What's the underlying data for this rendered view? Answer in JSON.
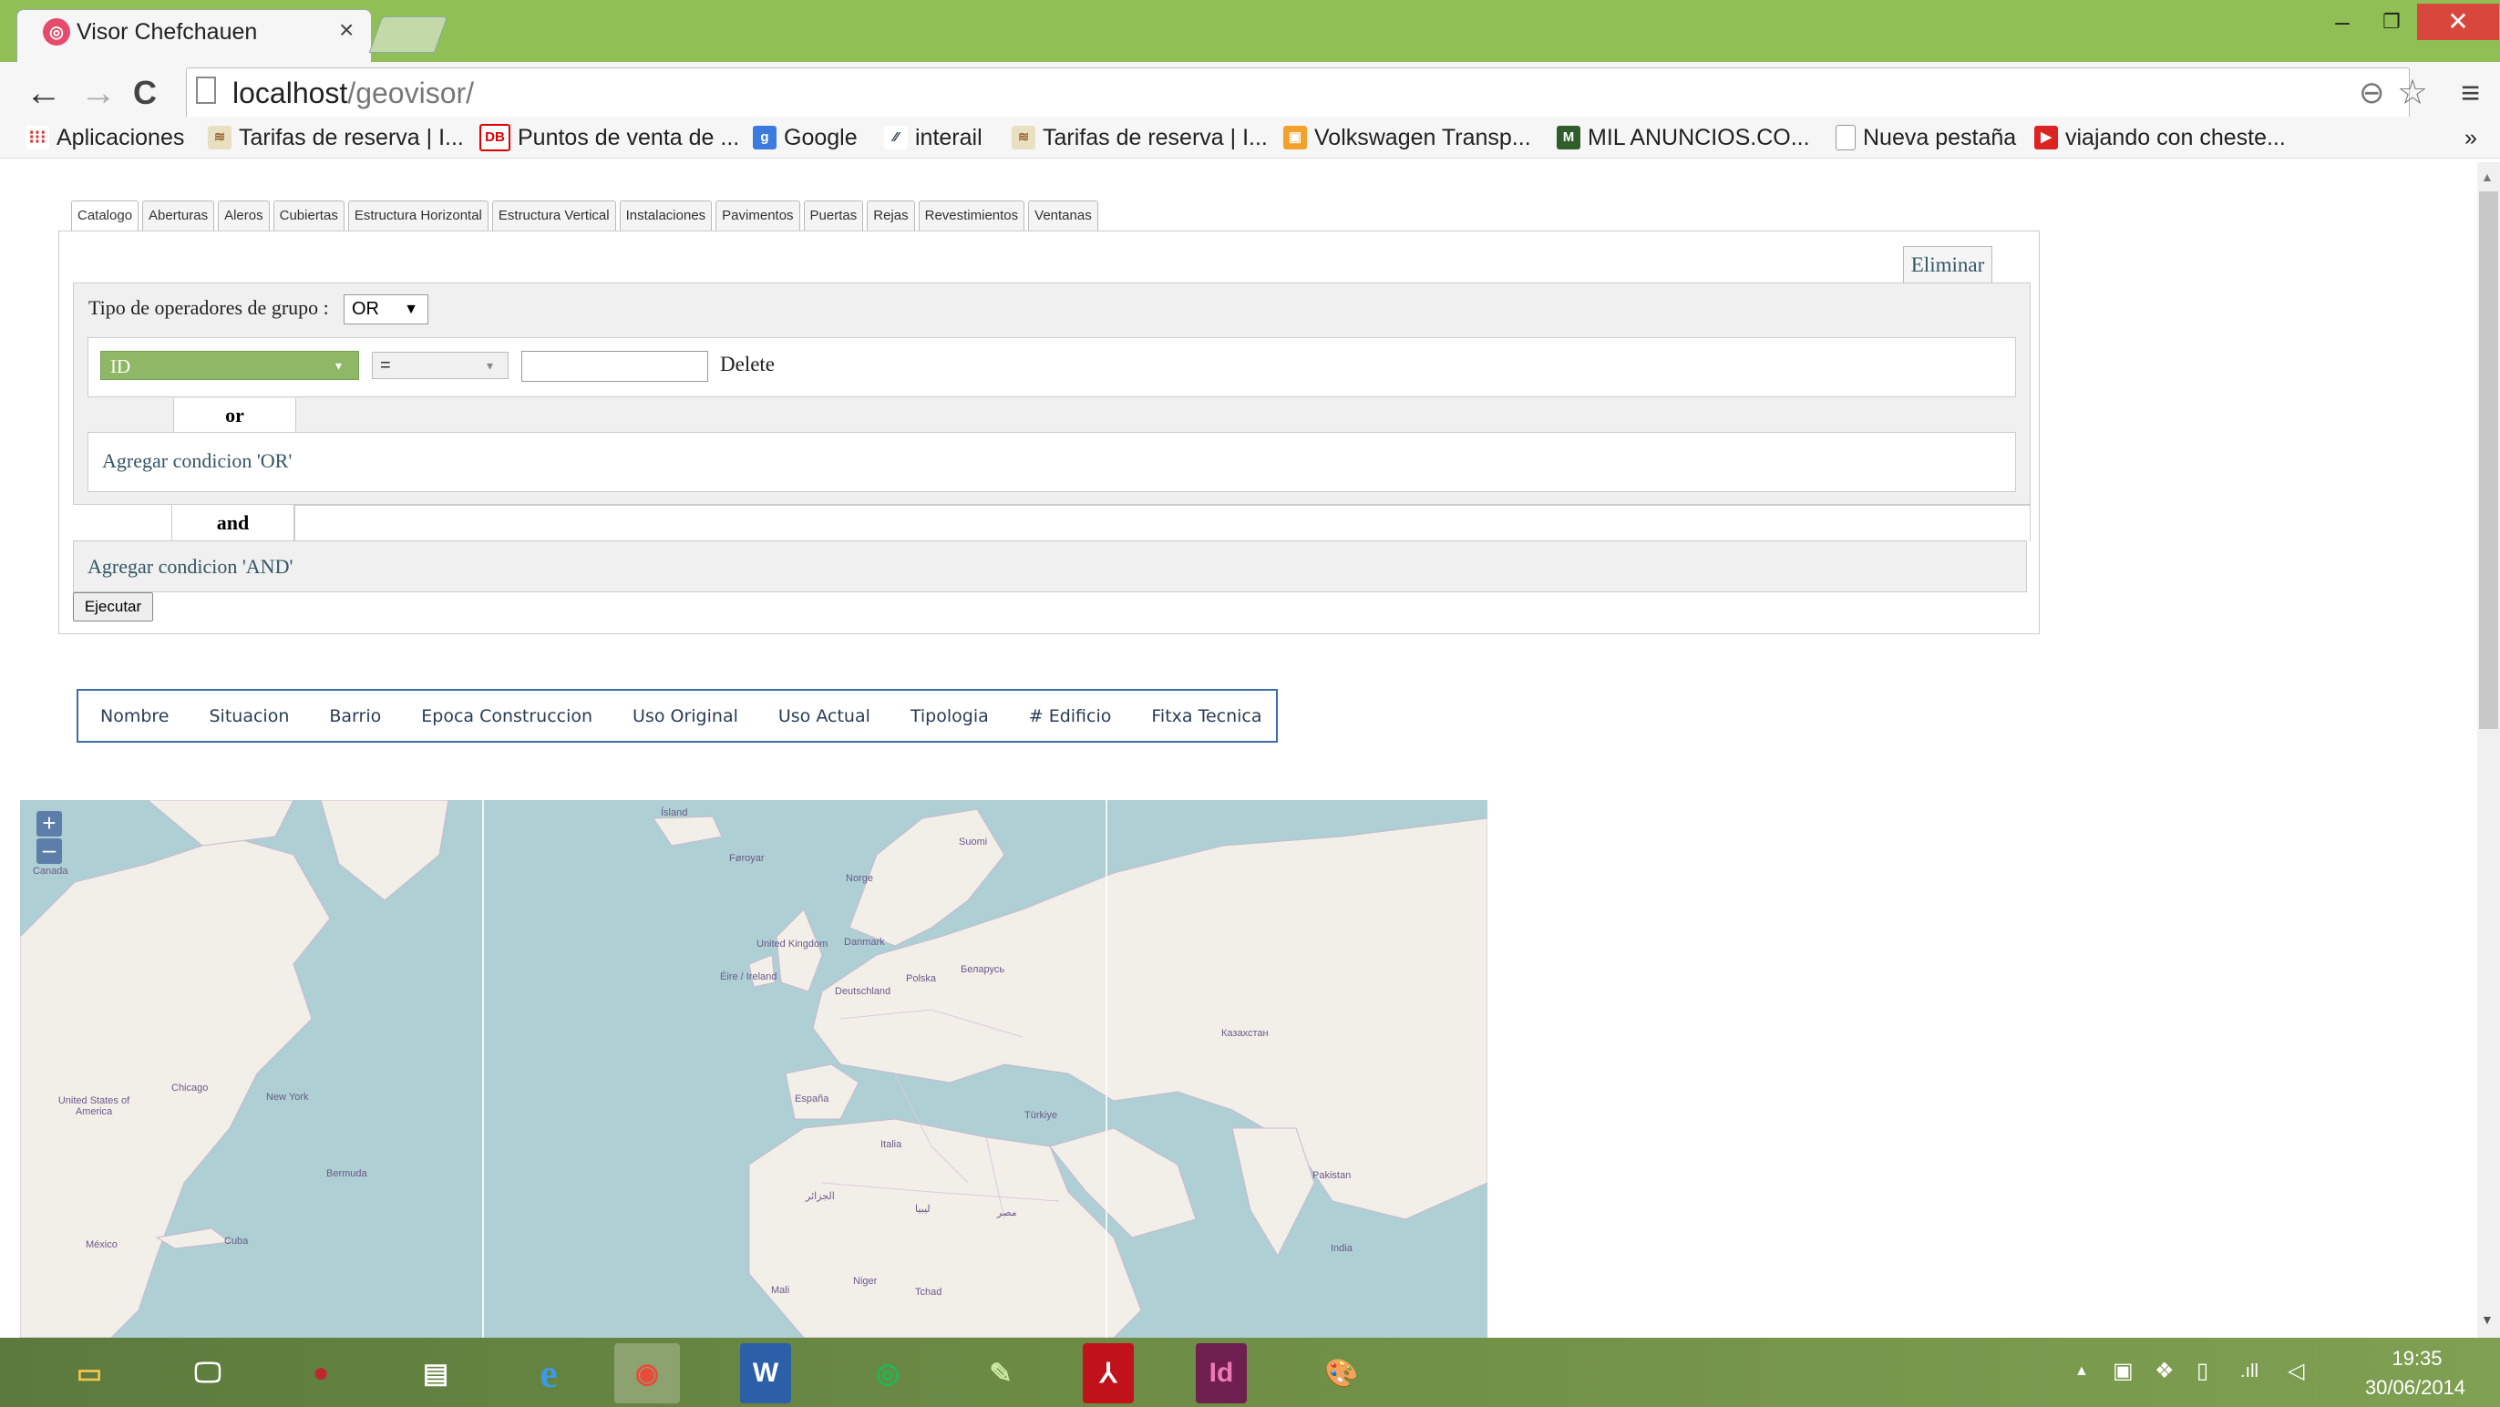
{
  "browser": {
    "tab_title": "Visor Chefchauen",
    "tab_close": "×",
    "url_host": "localhost",
    "url_path": "/geovisor/",
    "window_controls": {
      "minimize": "–",
      "restore": "❐",
      "close": "✕"
    },
    "nav": {
      "back": "←",
      "forward": "→",
      "reload": "C"
    },
    "bookmarks_overflow": "»",
    "bookmarks": [
      {
        "label": "Aplicaciones",
        "icon": "apps-grid-icon"
      },
      {
        "label": "Tarifas de reserva | I...",
        "icon": "renfe-icon"
      },
      {
        "label": "Puntos de venta de ...",
        "icon": "db-icon"
      },
      {
        "label": "Google",
        "icon": "google-icon"
      },
      {
        "label": "interail",
        "icon": "interail-icon"
      },
      {
        "label": "Tarifas de reserva | I...",
        "icon": "renfe-icon"
      },
      {
        "label": "Volkswagen Transp...",
        "icon": "box-icon"
      },
      {
        "label": "MIL ANUNCIOS.CO...",
        "icon": "milanuncios-icon"
      },
      {
        "label": "Nueva pestaña",
        "icon": "page-icon"
      },
      {
        "label": "viajando con cheste...",
        "icon": "youtube-icon"
      }
    ]
  },
  "catalog_tabs": [
    "Catalogo",
    "Aberturas",
    "Aleros",
    "Cubiertas",
    "Estructura Horizontal",
    "Estructura Vertical",
    "Instalaciones",
    "Pavimentos",
    "Puertas",
    "Rejas",
    "Revestimientos",
    "Ventanas"
  ],
  "query_builder": {
    "eliminar": "Eliminar",
    "group_operator_label": "Tipo de operadores de grupo :",
    "group_operator_value": "OR",
    "field_value": "ID",
    "comparator_value": "=",
    "value_input": "",
    "delete_label": "Delete",
    "or_label": "or",
    "add_or_label": "Agregar condicion 'OR'",
    "and_label": "and",
    "add_and_label": "Agregar condicion 'AND'",
    "execute_label": "Ejecutar"
  },
  "results_columns": [
    "Nombre",
    "Situacion",
    "Barrio",
    "Epoca Construccion",
    "Uso Original",
    "Uso Actual",
    "Tipologia",
    "# Edificio",
    "Fitxa Tecnica"
  ],
  "map": {
    "zoom_in": "+",
    "zoom_out": "–",
    "labels": [
      "Ísland",
      "Føroyar",
      "Suomi",
      "Norge",
      "United Kingdom",
      "Danmark",
      "Éire / Ireland",
      "Deutschland",
      "Polska",
      "Беларусь",
      "España",
      "Italia",
      "Türkiye",
      "الجزائر",
      "ليبيا",
      "مصر",
      "Niger",
      "Mali",
      "Tchad",
      "Canada",
      "United States of America",
      "México",
      "Cuba",
      "Казахстан",
      "India",
      "Pakistan",
      "Chicago",
      "New York",
      "Bermuda"
    ]
  },
  "taskbar": {
    "apps": [
      "file-explorer-icon",
      "remote-desktop-icon",
      "media-player-icon",
      "messaging-icon",
      "internet-explorer-icon",
      "chrome-icon",
      "word-icon",
      "spotify-icon",
      "notepadpp-icon",
      "acrobat-icon",
      "indesign-icon",
      "paint-icon"
    ],
    "tray_icons": [
      "show-hidden-icon",
      "battery-icon",
      "dropbox-icon",
      "network-icon",
      "signal-icon",
      "volume-icon"
    ],
    "time": "19:35",
    "date": "30/06/2014"
  },
  "colors": {
    "titlebar": "#8fbf55",
    "field_select": "#8fb866",
    "results_border": "#3a6ea5",
    "link": "#335566",
    "map_water": "#aecfd3",
    "map_land": "#f2efe9"
  }
}
